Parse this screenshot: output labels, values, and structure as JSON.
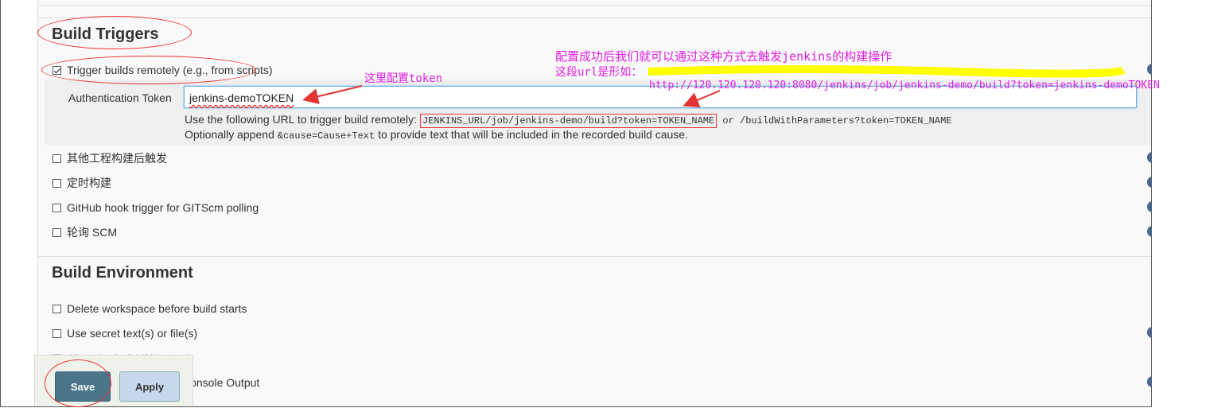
{
  "build_triggers": {
    "title": "Build Triggers",
    "trigger_remote": {
      "label": "Trigger builds remotely (e.g., from scripts)",
      "checked": true
    },
    "auth_token": {
      "label": "Authentication Token",
      "value": "jenkins-demoTOKEN"
    },
    "url_info": {
      "prefix": "Use the following URL to trigger build remotely: ",
      "url_code": "JENKINS_URL/job/jenkins-demo/build?token=TOKEN_NAME",
      "or_text": " or /buildWithParameters?token=TOKEN_NAME"
    },
    "append_info": {
      "prefix": "Optionally append ",
      "code": "&cause=Cause+Text",
      "suffix": " to provide text that will be included in the recorded build cause."
    },
    "options": [
      {
        "label": "其他工程构建后触发",
        "checked": false
      },
      {
        "label": "定时构建",
        "checked": false
      },
      {
        "label": "GitHub hook trigger for GITScm polling",
        "checked": false
      },
      {
        "label": "轮询 SCM",
        "checked": false
      }
    ]
  },
  "build_environment": {
    "title": "Build Environment",
    "options": [
      {
        "label": "Delete workspace before build starts",
        "checked": false
      },
      {
        "label": "Use secret text(s) or file(s)",
        "checked": false
      },
      {
        "label": "Abort the build if it's stuck",
        "checked": false
      },
      {
        "label": "Console Output",
        "checked": false
      }
    ]
  },
  "buttons": {
    "save": "Save",
    "apply": "Apply"
  },
  "annotations": {
    "token_note": "这里配置token",
    "success_note": "配置成功后我们就可以通过这种方式去触发jenkins的构建操作",
    "url_note": "这段url是形如：",
    "url_example": "http://120.120.120.120:8080/jenkins/job/jenkins-demo/build?token=jenkins-demoTOKEN"
  },
  "colors": {
    "annotation": "#e020e0",
    "highlight": "#ffff00",
    "circle": "#e33333",
    "save_button": "#4b758b",
    "apply_button": "#c5d8ec"
  }
}
